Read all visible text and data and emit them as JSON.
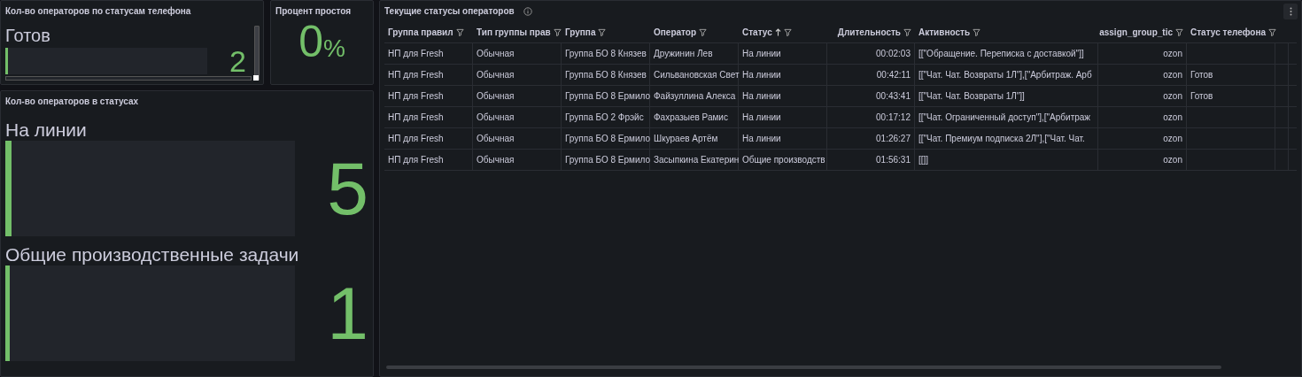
{
  "phone_status_panel": {
    "title": "Кол-во операторов по статусам телефона",
    "gauges": [
      {
        "label": "Готов",
        "value": "2",
        "level": 0.012
      }
    ]
  },
  "idle_panel": {
    "title": "Процент простоя",
    "value": "0",
    "unit": "%"
  },
  "status_count_panel": {
    "title": "Кол-во операторов в статусах",
    "gauges": [
      {
        "label": "На линии",
        "value": "5",
        "level": 0.02
      },
      {
        "label": "Общие производственные задачи",
        "value": "1",
        "level": 0.004
      }
    ]
  },
  "table_panel": {
    "title": "Текущие статусы операторов",
    "columns": [
      {
        "label": "Группа правил",
        "right_aligned": false,
        "sorted": false
      },
      {
        "label": "Тип группы прав",
        "right_aligned": false,
        "sorted": false
      },
      {
        "label": "Группа",
        "right_aligned": false,
        "sorted": false
      },
      {
        "label": "Оператор",
        "right_aligned": false,
        "sorted": false
      },
      {
        "label": "Статус",
        "right_aligned": false,
        "sorted": true
      },
      {
        "label": "Длительность",
        "right_aligned": true,
        "sorted": false
      },
      {
        "label": "Активность",
        "right_aligned": false,
        "sorted": false
      },
      {
        "label": "assign_group_tic",
        "right_aligned": true,
        "sorted": false
      },
      {
        "label": "Статус телефона",
        "right_aligned": false,
        "sorted": false
      }
    ],
    "rows": [
      [
        "НП для Fresh",
        "Обычная",
        "Группа БО 8 Князев",
        "Дружинин Лев",
        "На линии",
        "00:02:03",
        "[[\"Обращение. Переписка с доставкой\"]]",
        "ozon",
        ""
      ],
      [
        "НП для Fresh",
        "Обычная",
        "Группа БО 8 Князев",
        "Сильвановская Свет",
        "На линии",
        "00:42:11",
        "[[\"Чат. Чат. Возвраты 1Л\"],[\"Арбитраж. Арб",
        "ozon",
        "Готов"
      ],
      [
        "НП для Fresh",
        "Обычная",
        "Группа БО 8 Ермило",
        "Файзуллина Алекса",
        "На линии",
        "00:43:41",
        "[[\"Чат. Чат. Возвраты 1Л\"]]",
        "ozon",
        "Готов"
      ],
      [
        "НП для Fresh",
        "Обычная",
        "Группа БО 2 Фрэйс",
        "Фахразыев Рамис",
        "На линии",
        "00:17:12",
        "[[\"Чат. Ограниченный доступ\"],[\"Арбитраж",
        "ozon",
        ""
      ],
      [
        "НП для Fresh",
        "Обычная",
        "Группа БО 8 Ермило",
        "Шкураев Артём",
        "На линии",
        "01:26:27",
        "[[\"Чат. Премиум подписка 2Л\"],[\"Чат. Чат.",
        "ozon",
        ""
      ],
      [
        "НП для Fresh",
        "Обычная",
        "Группа БО 8 Ермило",
        "Засыпкина Екатерин",
        "Общие производств",
        "01:56:31",
        "[[]]",
        "ozon",
        ""
      ]
    ]
  }
}
